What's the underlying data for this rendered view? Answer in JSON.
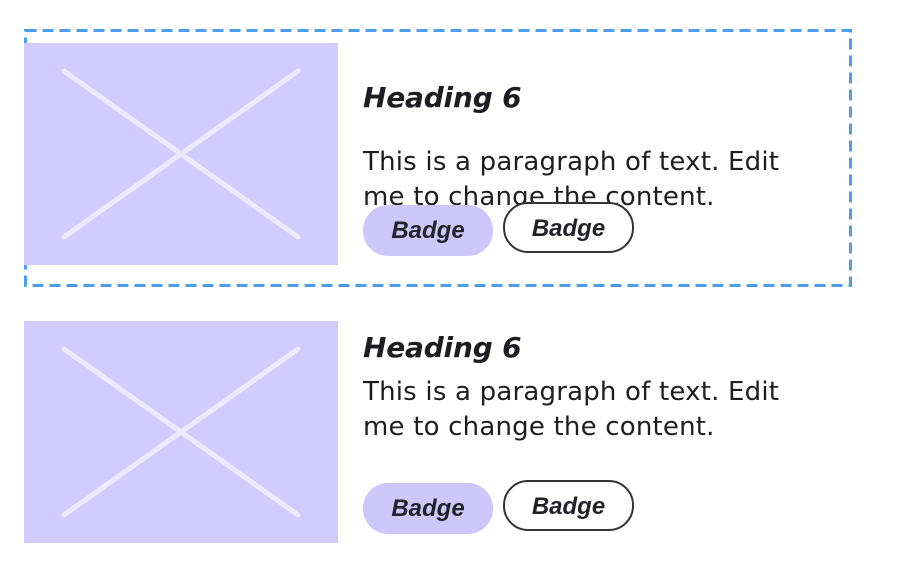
{
  "colors": {
    "selection_outline": "#4a9df0",
    "placeholder_background": "#d1cbff",
    "placeholder_cross": "#eeeafe",
    "filled_badge_background": "#cdc7fb",
    "text": "#1d1d22",
    "badge_outline": "#333333"
  },
  "cards": [
    {
      "selected": true,
      "image_icon": "image-placeholder-icon",
      "heading": "Heading 6",
      "paragraph": "This is a paragraph of text. Edit me to change the content.",
      "badges": [
        {
          "label": "Badge",
          "style": "filled"
        },
        {
          "label": "Badge",
          "style": "outline"
        }
      ]
    },
    {
      "selected": false,
      "image_icon": "image-placeholder-icon",
      "heading": "Heading 6",
      "paragraph": "This is a paragraph of text. Edit me to change the content.",
      "badges": [
        {
          "label": "Badge",
          "style": "filled"
        },
        {
          "label": "Badge",
          "style": "outline"
        }
      ]
    }
  ]
}
